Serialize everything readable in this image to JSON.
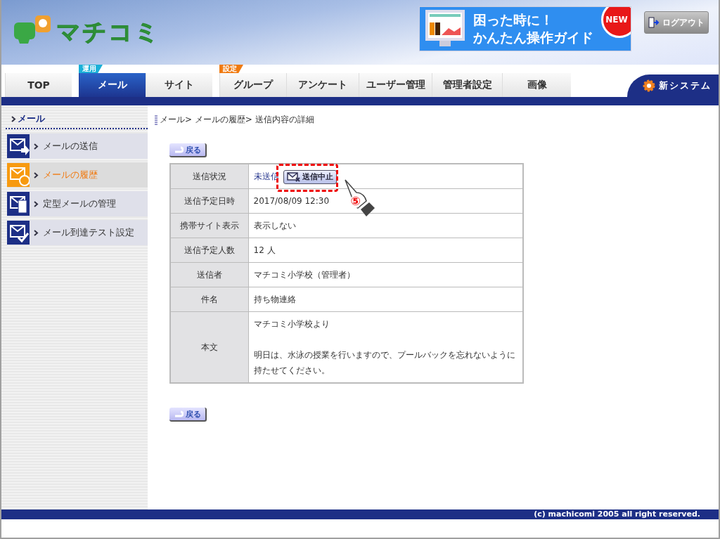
{
  "header": {
    "logo_text": "マチコミ",
    "banner": {
      "lines": [
        "困った時に！",
        "かんたん操作ガイド"
      ],
      "badge": "NEW"
    },
    "logout": "ログアウト"
  },
  "tabs": [
    {
      "label": "TOP",
      "selected": false
    },
    {
      "label": "メール",
      "tag": "運用",
      "color": "#1ab0d8",
      "selected": true
    },
    {
      "label": "サイト",
      "selected": false
    },
    {
      "label": "グループ",
      "tag": "設定",
      "color": "#f07a10",
      "selected": false
    },
    {
      "label": "アンケート",
      "selected": false
    },
    {
      "label": "ユーザー管理",
      "selected": false
    },
    {
      "label": "管理者設定",
      "selected": false
    },
    {
      "label": "画像",
      "selected": false
    }
  ],
  "new_system": "新システム",
  "sidebar": {
    "heading": "メール",
    "items": [
      {
        "label": "メールの送信",
        "kind": "send",
        "selected": false
      },
      {
        "label": "メールの履歴",
        "kind": "history",
        "selected": true
      },
      {
        "label": "定型メールの管理",
        "kind": "template",
        "selected": false
      },
      {
        "label": " メール到達テスト設定",
        "kind": "test",
        "selected": false
      }
    ]
  },
  "breadcrumb": "メール> メールの履歴> 送信内容の詳細",
  "back_buttons": [
    "戻る",
    "戻る"
  ],
  "table": {
    "rows": [
      {
        "kind": "status",
        "label": "送信状況",
        "value": "未送信",
        "button": "送信中止",
        "annotation": "⑤"
      },
      {
        "kind": "text",
        "label": "送信予定日時",
        "value": "2017/08/09 12:30"
      },
      {
        "kind": "text",
        "label": "携帯サイト表示",
        "value": "表示しない"
      },
      {
        "kind": "text",
        "label": "送信予定人数",
        "value": "12 人"
      },
      {
        "kind": "text",
        "label": "送信者",
        "value": "マチコミ小学校（管理者）"
      },
      {
        "kind": "text",
        "label": "件名",
        "value": "持ち物連絡"
      },
      {
        "kind": "body",
        "label": "本文",
        "paragraphs": [
          "マチコミ小学校より",
          "明日は、水泳の授業を行いますので、プールバックを忘れないように持たせてください。"
        ]
      }
    ]
  },
  "footer": "(c) machicomi 2005 all right reserved."
}
